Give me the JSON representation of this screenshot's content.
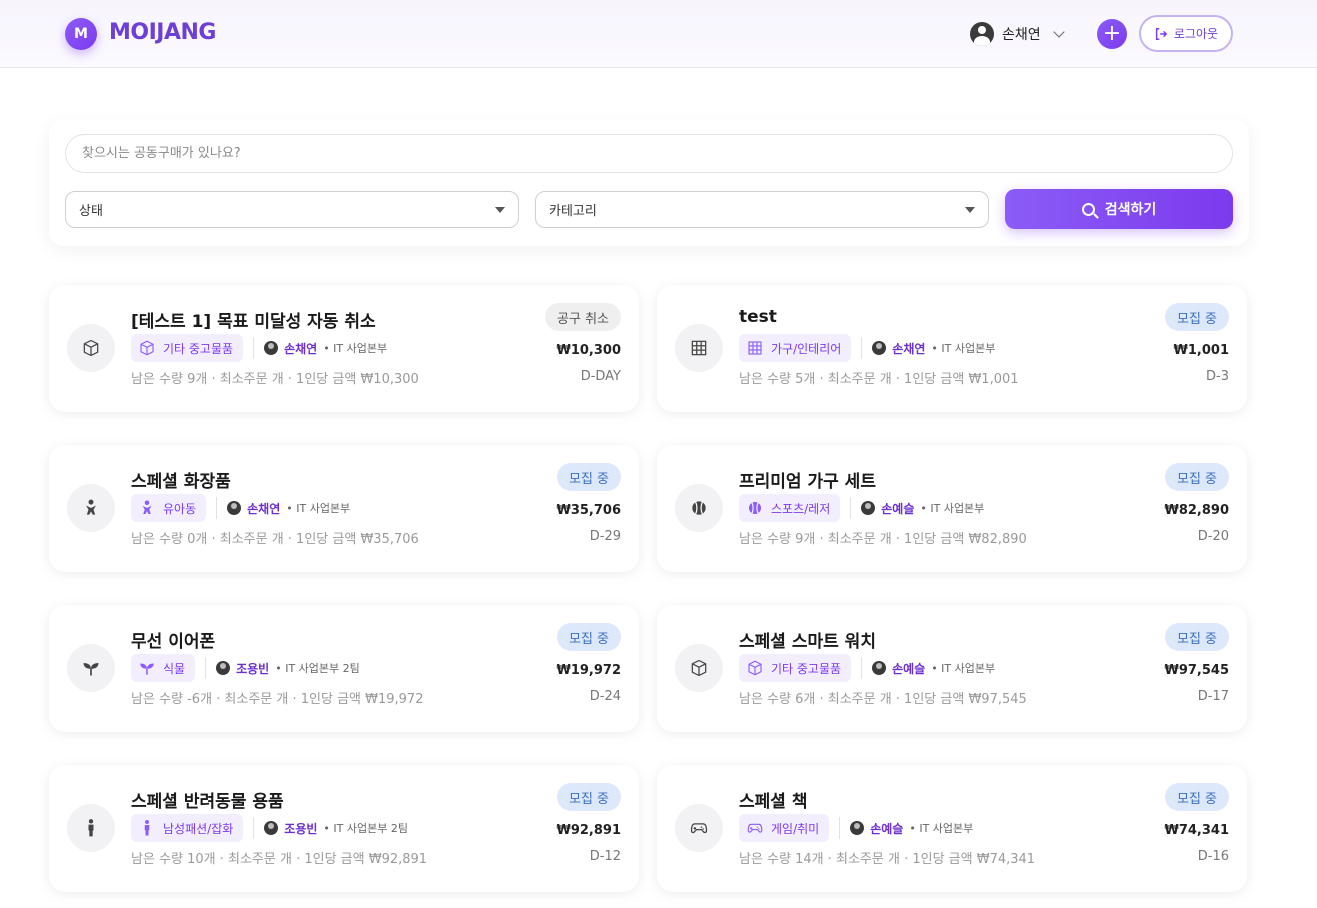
{
  "header": {
    "logo_mark": "M",
    "logo_text": "MOIJANG",
    "user_name": "손채연",
    "add_label": "+",
    "logout_label": "로그아웃"
  },
  "search": {
    "placeholder": "찾으시는 공동구매가 있나요?",
    "status_select": "상태",
    "category_select": "카테고리",
    "button_label": "검색하기"
  },
  "colors": {
    "accent": "#7c3aed",
    "status_open_bg": "#dde8fb",
    "status_open_text": "#3d6ec2",
    "status_cancel_bg": "#efefef"
  },
  "cards": [
    {
      "title": "[테스트 1] 목표 미달성 자동 취소",
      "icon": "box-icon",
      "category": "기타 중고물품",
      "owner": "손채연",
      "dept": "• IT 사업본부",
      "info": "남은 수량 9개 · 최소주문 개 · 1인당 금액 ₩10,300",
      "status": "공구 취소",
      "price": "₩10,300",
      "dday": "D-DAY"
    },
    {
      "title": "test",
      "icon": "grid-icon",
      "category": "가구/인테리어",
      "owner": "손채연",
      "dept": "• IT 사업본부",
      "info": "남은 수량 5개 · 최소주문 개 · 1인당 금액 ₩1,001",
      "status": "모집 중",
      "price": "₩1,001",
      "dday": "D-3"
    },
    {
      "title": "스페셜 화장품",
      "icon": "baby-icon",
      "category": "유아동",
      "owner": "손채연",
      "dept": "• IT 사업본부",
      "info": "남은 수량 0개 · 최소주문 개 · 1인당 금액 ₩35,706",
      "status": "모집 중",
      "price": "₩35,706",
      "dday": "D-29"
    },
    {
      "title": "프리미엄 가구 세트",
      "icon": "ball-icon",
      "category": "스포츠/레저",
      "owner": "손예슬",
      "dept": "• IT 사업본부",
      "info": "남은 수량 9개 · 최소주문 개 · 1인당 금액 ₩82,890",
      "status": "모집 중",
      "price": "₩82,890",
      "dday": "D-20"
    },
    {
      "title": "무선 이어폰",
      "icon": "sprout-icon",
      "category": "식물",
      "owner": "조용빈",
      "dept": "• IT 사업본부 2팀",
      "info": "남은 수량 -6개 · 최소주문 개 · 1인당 금액 ₩19,972",
      "status": "모집 중",
      "price": "₩19,972",
      "dday": "D-24"
    },
    {
      "title": "스페셜 스마트 워치",
      "icon": "box-icon",
      "category": "기타 중고물품",
      "owner": "손예슬",
      "dept": "• IT 사업본부",
      "info": "남은 수량 6개 · 최소주문 개 · 1인당 금액 ₩97,545",
      "status": "모집 중",
      "price": "₩97,545",
      "dday": "D-17"
    },
    {
      "title": "스페셜 반려동물 용품",
      "icon": "person-icon",
      "category": "남성패션/잡화",
      "owner": "조용빈",
      "dept": "• IT 사업본부 2팀",
      "info": "남은 수량 10개 · 최소주문 개 · 1인당 금액 ₩92,891",
      "status": "모집 중",
      "price": "₩92,891",
      "dday": "D-12"
    },
    {
      "title": "스페셜 책",
      "icon": "gamepad-icon",
      "category": "게임/취미",
      "owner": "손예슬",
      "dept": "• IT 사업본부",
      "info": "남은 수량 14개 · 최소주문 개 · 1인당 금액 ₩74,341",
      "status": "모집 중",
      "price": "₩74,341",
      "dday": "D-16"
    }
  ]
}
